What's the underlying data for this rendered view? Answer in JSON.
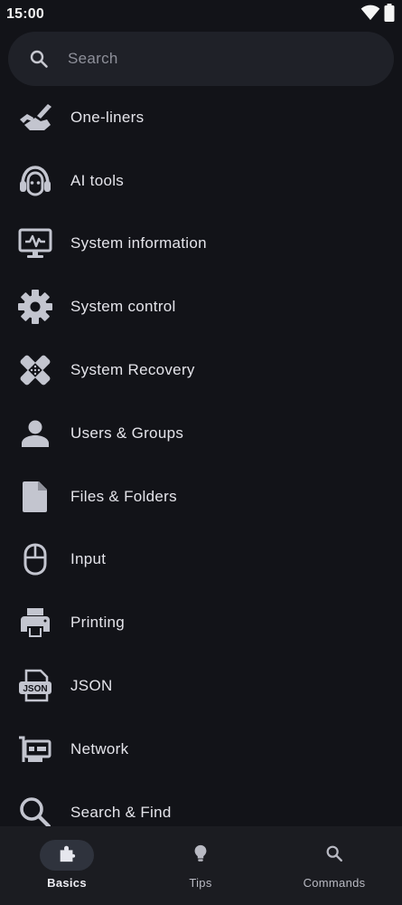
{
  "status_bar": {
    "time": "15:00"
  },
  "search": {
    "placeholder": "Search"
  },
  "list": {
    "items": [
      {
        "label": "One-liners",
        "icon": "hand-writing-icon"
      },
      {
        "label": "AI tools",
        "icon": "robot-head-icon"
      },
      {
        "label": "System information",
        "icon": "monitor-pulse-icon"
      },
      {
        "label": "System control",
        "icon": "gear-icon"
      },
      {
        "label": "System Recovery",
        "icon": "bandage-icon"
      },
      {
        "label": "Users & Groups",
        "icon": "person-icon"
      },
      {
        "label": "Files & Folders",
        "icon": "file-icon"
      },
      {
        "label": "Input",
        "icon": "mouse-icon"
      },
      {
        "label": "Printing",
        "icon": "printer-icon"
      },
      {
        "label": "JSON",
        "icon": "json-file-icon"
      },
      {
        "label": "Network",
        "icon": "network-card-icon"
      },
      {
        "label": "Search & Find",
        "icon": "magnifier-icon"
      }
    ]
  },
  "bottom_nav": {
    "items": [
      {
        "label": "Basics",
        "icon": "puzzle-icon",
        "active": true
      },
      {
        "label": "Tips",
        "icon": "lightbulb-icon",
        "active": false
      },
      {
        "label": "Commands",
        "icon": "search-icon",
        "active": false
      }
    ]
  },
  "colors": {
    "background": "#121318",
    "surface": "#1f2128",
    "nav_background": "#1b1c21",
    "icon": "#c3c5cf",
    "text": "#e4e4ea"
  }
}
